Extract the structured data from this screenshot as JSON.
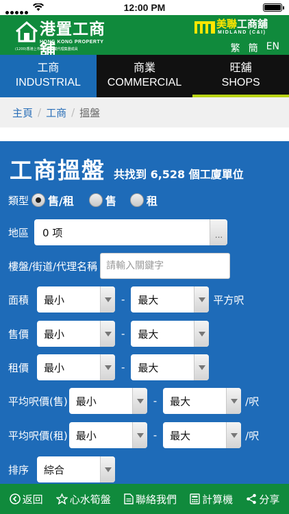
{
  "status": {
    "time": "12:00 PM"
  },
  "header": {
    "logo_cn": "港置工商舖",
    "logo_en": "HONG KONG PROPERTY",
    "logo_tag": "(1200)香港上市工商舖物業代理集團成員",
    "partner_cn_a": "美聯",
    "partner_cn_b": "工商舖",
    "partner_en": "MIDLAND (C&I)",
    "lang": [
      "繁",
      "簡",
      "EN"
    ]
  },
  "nav": {
    "tabs": [
      {
        "cn": "工商",
        "en": "INDUSTRIAL"
      },
      {
        "cn": "商業",
        "en": "COMMERCIAL"
      },
      {
        "cn": "旺舖",
        "en": "SHOPS"
      }
    ]
  },
  "breadcrumb": {
    "home": "主頁",
    "section": "工商",
    "current": "搵盤",
    "sep": "/"
  },
  "search": {
    "title": "工商搵盤",
    "count_text": "共找到 6,528 個工廈單位",
    "type_label": "類型",
    "type_options": [
      "售/租",
      "售",
      "租"
    ],
    "district_label": "地區",
    "district_value": "0 项",
    "district_more": "...",
    "keyword_label": "樓盤/街道/代理名稱",
    "keyword_placeholder": "請輸入關鍵字",
    "area_label": "面積",
    "area_unit": "平方呎",
    "sale_label": "售價",
    "rent_label": "租價",
    "avg_sale_label": "平均呎價(售)",
    "avg_rent_label": "平均呎價(租)",
    "per_sqft": "/呎",
    "min": "最小",
    "max": "最大",
    "dash": "-",
    "sort_label": "排序",
    "sort_value": "綜合"
  },
  "bottom": {
    "back": "返回",
    "favorite": "心水筍盤",
    "contact": "聯絡我們",
    "calculator": "計算機",
    "share": "分享"
  },
  "colors": {
    "header_green": "#108a3c",
    "panel_blue": "#1e6bb8",
    "tab_active": "#1a6bb5",
    "shops_accent": "#b9d315"
  }
}
